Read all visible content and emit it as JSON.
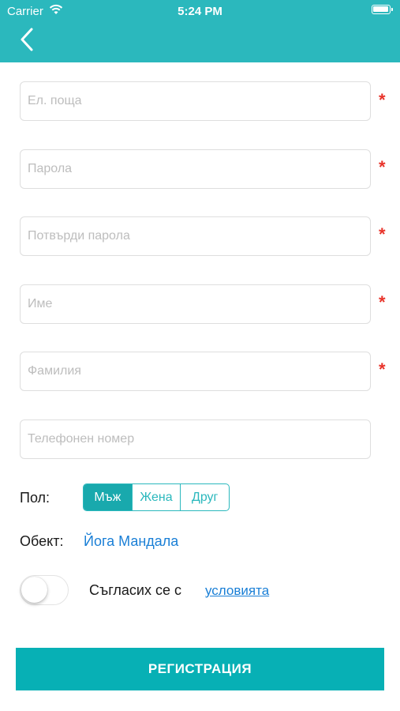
{
  "status_bar": {
    "carrier": "Carrier",
    "time": "5:24 PM"
  },
  "nav": {
    "back_icon": "chevron-left-icon"
  },
  "form": {
    "email": {
      "placeholder": "Ел. поща",
      "value": "",
      "required_mark": "*"
    },
    "password": {
      "placeholder": "Парола",
      "value": "",
      "required_mark": "*"
    },
    "confirm_password": {
      "placeholder": "Потвърди парола",
      "value": "",
      "required_mark": "*"
    },
    "first_name": {
      "placeholder": "Име",
      "value": "",
      "required_mark": "*"
    },
    "last_name": {
      "placeholder": "Фамилия",
      "value": "",
      "required_mark": "*"
    },
    "phone": {
      "placeholder": "Телефонен номер",
      "value": ""
    }
  },
  "gender": {
    "label": "Пол:",
    "options": [
      "Мъж",
      "Жена",
      "Друг"
    ],
    "selected": "Мъж"
  },
  "facility": {
    "label": "Обект:",
    "value": "Йога Мандала"
  },
  "terms": {
    "toggle_on": false,
    "text": "Съгласих се с",
    "link": "условията"
  },
  "submit": {
    "label": "РЕГИСТРАЦИЯ"
  },
  "colors": {
    "accent": "#2bb8bd",
    "button": "#07b0b5",
    "required": "#e8332a",
    "link": "#1a7fd6"
  }
}
